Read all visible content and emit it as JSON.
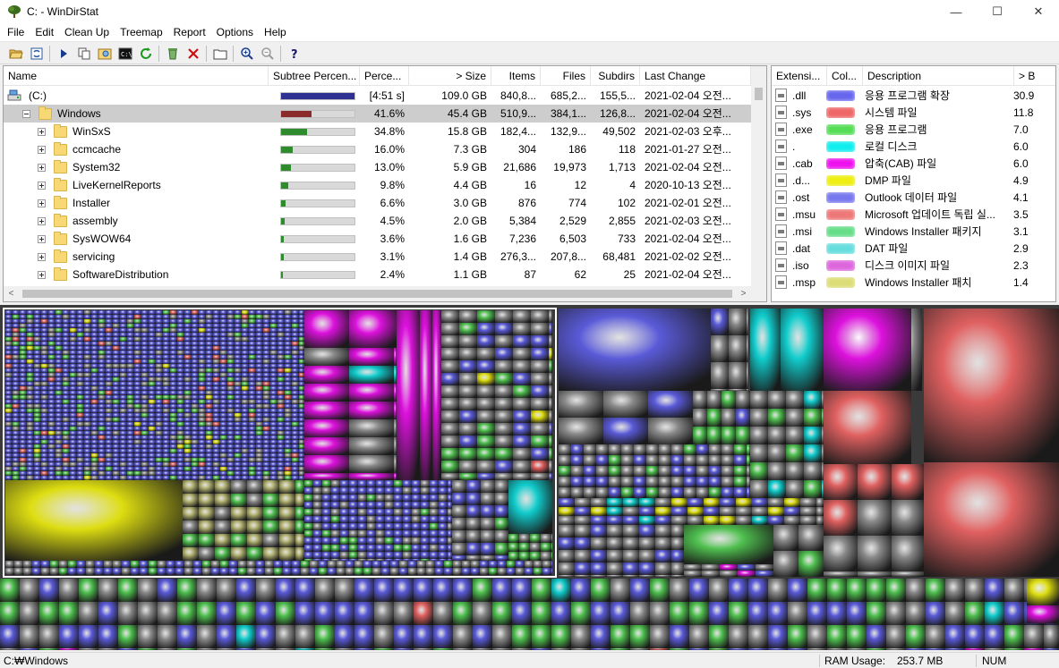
{
  "window": {
    "title": "C: - WinDirStat",
    "minimize": "—",
    "maximize": "☐",
    "close": "✕"
  },
  "menu": [
    "File",
    "Edit",
    "Clean Up",
    "Treemap",
    "Report",
    "Options",
    "Help"
  ],
  "toolbar": [
    "open-icon",
    "refresh-icon",
    "play-icon",
    "copy-icon",
    "explorer-icon",
    "command-prompt-icon",
    "refresh-selected-icon",
    "recycle-bin-icon",
    "delete-icon",
    "new-folder-icon",
    "zoom-in-icon",
    "zoom-out-icon",
    "help-icon"
  ],
  "tree": {
    "columns": [
      "Name",
      "Subtree Percen...",
      "Perce...",
      "> Size",
      "Items",
      "Files",
      "Subdirs",
      "Last Change"
    ],
    "rows": [
      {
        "name": "(C:)",
        "kind": "drive",
        "expander": "none",
        "indent": 0,
        "bar": 1.0,
        "bar_color": "#2e3192",
        "percent": "[4:51 s]",
        "size": "109.0 GB",
        "items": "840,8...",
        "files": "685,2...",
        "subdirs": "155,5...",
        "last_change": "2021-02-04  오전..."
      },
      {
        "name": "Windows",
        "kind": "folder",
        "expander": "minus",
        "indent": 1,
        "bar": 0.416,
        "bar_color": "#8b2a2a",
        "percent": "41.6%",
        "size": "45.4 GB",
        "items": "510,9...",
        "files": "384,1...",
        "subdirs": "126,8...",
        "last_change": "2021-02-04  오전...",
        "selected": true
      },
      {
        "name": "WinSxS",
        "kind": "folder",
        "expander": "plus",
        "indent": 2,
        "bar": 0.348,
        "bar_color": "#2e8b2e",
        "percent": "34.8%",
        "size": "15.8 GB",
        "items": "182,4...",
        "files": "132,9...",
        "subdirs": "49,502",
        "last_change": "2021-02-03  오후..."
      },
      {
        "name": "ccmcache",
        "kind": "folder",
        "expander": "plus",
        "indent": 2,
        "bar": 0.16,
        "bar_color": "#2e8b2e",
        "percent": "16.0%",
        "size": "7.3 GB",
        "items": "304",
        "files": "186",
        "subdirs": "118",
        "last_change": "2021-01-27  오전..."
      },
      {
        "name": "System32",
        "kind": "folder",
        "expander": "plus",
        "indent": 2,
        "bar": 0.13,
        "bar_color": "#2e8b2e",
        "percent": "13.0%",
        "size": "5.9 GB",
        "items": "21,686",
        "files": "19,973",
        "subdirs": "1,713",
        "last_change": "2021-02-04  오전..."
      },
      {
        "name": "LiveKernelReports",
        "kind": "folder",
        "expander": "plus",
        "indent": 2,
        "bar": 0.098,
        "bar_color": "#2e8b2e",
        "percent": "9.8%",
        "size": "4.4 GB",
        "items": "16",
        "files": "12",
        "subdirs": "4",
        "last_change": "2020-10-13  오전..."
      },
      {
        "name": "Installer",
        "kind": "folder",
        "expander": "plus",
        "indent": 2,
        "bar": 0.066,
        "bar_color": "#2e8b2e",
        "percent": "6.6%",
        "size": "3.0 GB",
        "items": "876",
        "files": "774",
        "subdirs": "102",
        "last_change": "2021-02-01  오전..."
      },
      {
        "name": "assembly",
        "kind": "folder",
        "expander": "plus",
        "indent": 2,
        "bar": 0.045,
        "bar_color": "#2e8b2e",
        "percent": "4.5%",
        "size": "2.0 GB",
        "items": "5,384",
        "files": "2,529",
        "subdirs": "2,855",
        "last_change": "2021-02-03  오전..."
      },
      {
        "name": "SysWOW64",
        "kind": "folder",
        "expander": "plus",
        "indent": 2,
        "bar": 0.036,
        "bar_color": "#2e8b2e",
        "percent": "3.6%",
        "size": "1.6 GB",
        "items": "7,236",
        "files": "6,503",
        "subdirs": "733",
        "last_change": "2021-02-04  오전..."
      },
      {
        "name": "servicing",
        "kind": "folder",
        "expander": "plus",
        "indent": 2,
        "bar": 0.031,
        "bar_color": "#2e8b2e",
        "percent": "3.1%",
        "size": "1.4 GB",
        "items": "276,3...",
        "files": "207,8...",
        "subdirs": "68,481",
        "last_change": "2021-02-02  오전..."
      },
      {
        "name": "SoftwareDistribution",
        "kind": "folder",
        "expander": "plus",
        "indent": 2,
        "bar": 0.024,
        "bar_color": "#2e8b2e",
        "percent": "2.4%",
        "size": "1.1 GB",
        "items": "87",
        "files": "62",
        "subdirs": "25",
        "last_change": "2021-02-04  오전..."
      }
    ]
  },
  "extensions": {
    "columns": [
      "Extensi...",
      "Col...",
      "Description",
      "> B"
    ],
    "rows": [
      {
        "ext": ".dll",
        "color": "#6666ee",
        "desc": "응용 프로그램 확장",
        "bytes": "30.9"
      },
      {
        "ext": ".sys",
        "color": "#ee6666",
        "desc": "시스템 파일",
        "bytes": "11.8"
      },
      {
        "ext": ".exe",
        "color": "#55dd55",
        "desc": "응용 프로그램",
        "bytes": "7.0"
      },
      {
        "ext": ".",
        "color": "#11eeee",
        "desc": "로컬 디스크",
        "bytes": "6.0"
      },
      {
        "ext": ".cab",
        "color": "#ee11ee",
        "desc": "압축(CAB) 파일",
        "bytes": "6.0"
      },
      {
        "ext": ".d...",
        "color": "#eeee11",
        "desc": "DMP 파일",
        "bytes": "4.9"
      },
      {
        "ext": ".ost",
        "color": "#7777ee",
        "desc": "Outlook 데이터 파일",
        "bytes": "4.1"
      },
      {
        "ext": ".msu",
        "color": "#ee7777",
        "desc": "Microsoft 업데이트 독립 실...",
        "bytes": "3.5"
      },
      {
        "ext": ".msi",
        "color": "#66dd88",
        "desc": "Windows Installer 패키지",
        "bytes": "3.1"
      },
      {
        "ext": ".dat",
        "color": "#66dddd",
        "desc": "DAT 파일",
        "bytes": "2.9"
      },
      {
        "ext": ".iso",
        "color": "#dd66dd",
        "desc": "디스크 이미지 파일",
        "bytes": "2.3"
      },
      {
        "ext": ".msp",
        "color": "#dddd77",
        "desc": "Windows Installer 패치",
        "bytes": "1.4"
      }
    ]
  },
  "status": {
    "path": "C:₩Windows",
    "ram_label": "RAM Usage:",
    "ram_value": "253.7 MB",
    "num": "NUM"
  }
}
